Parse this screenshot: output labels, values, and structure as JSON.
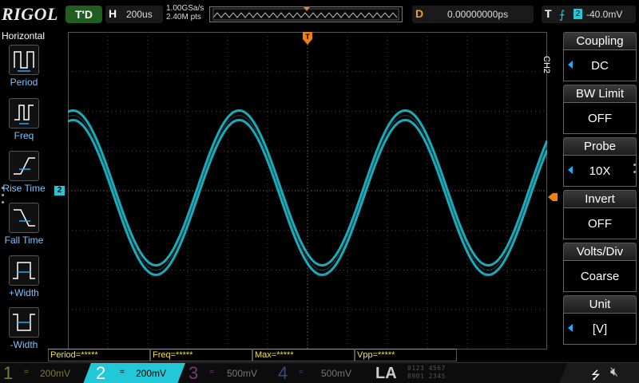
{
  "brand": "RIGOL",
  "status": "T'D",
  "horizontal": {
    "key": "H",
    "timebase": "200us",
    "sample_rate": "1.00GSa/s",
    "mem_depth": "2.40M pts"
  },
  "delay": {
    "key": "D",
    "value": "0.00000000ps"
  },
  "trigger": {
    "key": "T",
    "edge_icon": "rising-edge-icon",
    "source": "2",
    "level": "-40.0mV"
  },
  "left_menu": {
    "title": "Horizontal",
    "items": [
      {
        "label": "Period",
        "icon": "period-icon"
      },
      {
        "label": "Freq",
        "icon": "freq-icon"
      },
      {
        "label": "Rise Time",
        "icon": "rise-time-icon"
      },
      {
        "label": "Fall Time",
        "icon": "fall-time-icon"
      },
      {
        "label": "+Width",
        "icon": "pos-width-icon"
      },
      {
        "label": "-Width",
        "icon": "neg-width-icon"
      }
    ]
  },
  "channel_marker": "2",
  "right_menu": {
    "channel_label": "CH2",
    "items": [
      {
        "title": "Coupling",
        "value": "DC",
        "has_arrow": true
      },
      {
        "title": "BW Limit",
        "value": "OFF",
        "has_arrow": false
      },
      {
        "title": "Probe",
        "value": "10X",
        "has_arrow": true
      },
      {
        "title": "Invert",
        "value": "OFF",
        "has_arrow": false
      },
      {
        "title": "Volts/Div",
        "value": "Coarse",
        "has_arrow": false
      },
      {
        "title": "Unit",
        "value": "[V]",
        "has_arrow": true
      }
    ]
  },
  "measurements": [
    {
      "text": "Period=*****"
    },
    {
      "text": "Freq=*****"
    },
    {
      "text": "Max=*****"
    },
    {
      "text": "Vpp=*****"
    }
  ],
  "channels": [
    {
      "num": "1",
      "coupling": "=",
      "scale": "200mV"
    },
    {
      "num": "2",
      "coupling": "=",
      "scale": "200mV"
    },
    {
      "num": "3",
      "coupling": "=",
      "scale": "500mV"
    },
    {
      "num": "4",
      "coupling": "=",
      "scale": "500mV"
    }
  ],
  "la": {
    "label": "LA",
    "row1": "0123 4567",
    "row2": "8901 2345"
  },
  "colors": {
    "ch1": "#b8b830",
    "ch2": "#22c8d8",
    "ch3": "#c030c0",
    "ch4": "#3050c0",
    "trigger": "#f08010",
    "measure": "#f0e040"
  },
  "waveform": {
    "type": "sine",
    "cycles_visible": 2.4,
    "period_divisions": 4.16,
    "amplitude_divisions": 3.9
  }
}
